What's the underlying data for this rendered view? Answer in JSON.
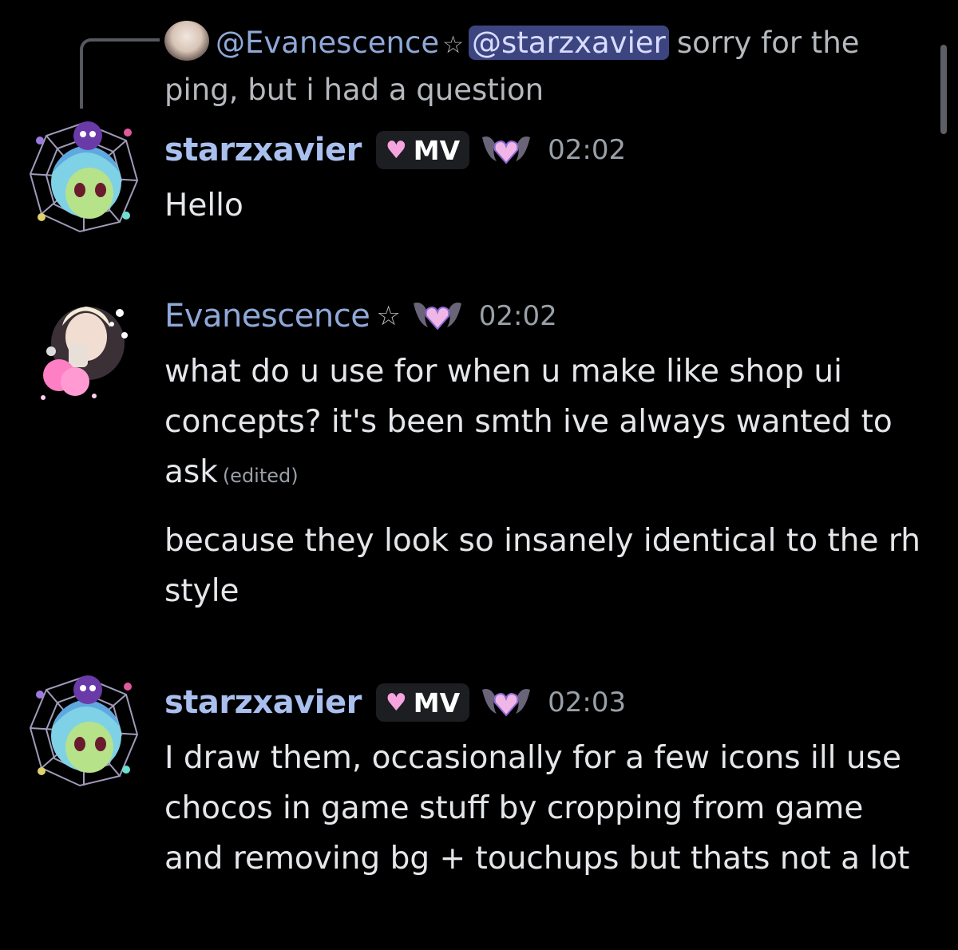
{
  "reply": {
    "author": "@Evanescence",
    "star": "☆",
    "mention": "@starzxavier",
    "text": "sorry for the ping, but i had a question"
  },
  "messages": [
    {
      "author": "starzxavier",
      "role": "MV",
      "time": "02:02",
      "lines": [
        "Hello"
      ]
    },
    {
      "author": "Evanescence",
      "star": "☆",
      "time": "02:02",
      "text": "what do u use for when u make like shop ui concepts? it's been smth ive always wanted to ask",
      "edited": "(edited)",
      "followup": "because they look so insanely identical to the rh style"
    },
    {
      "author": "starzxavier",
      "role": "MV",
      "time": "02:03",
      "text": "I draw them, occasionally for a few icons ill use chocos in game stuff by cropping from game and removing bg + touchups but thats not a lot"
    }
  ],
  "icons": {
    "role_badge": "heart-icon",
    "server_badge": "bat-heart-icon"
  },
  "colors": {
    "background": "#000000",
    "username": "#a9c0ef",
    "mention_bg": "#3d4580",
    "timestamp": "#9aa0a8"
  }
}
